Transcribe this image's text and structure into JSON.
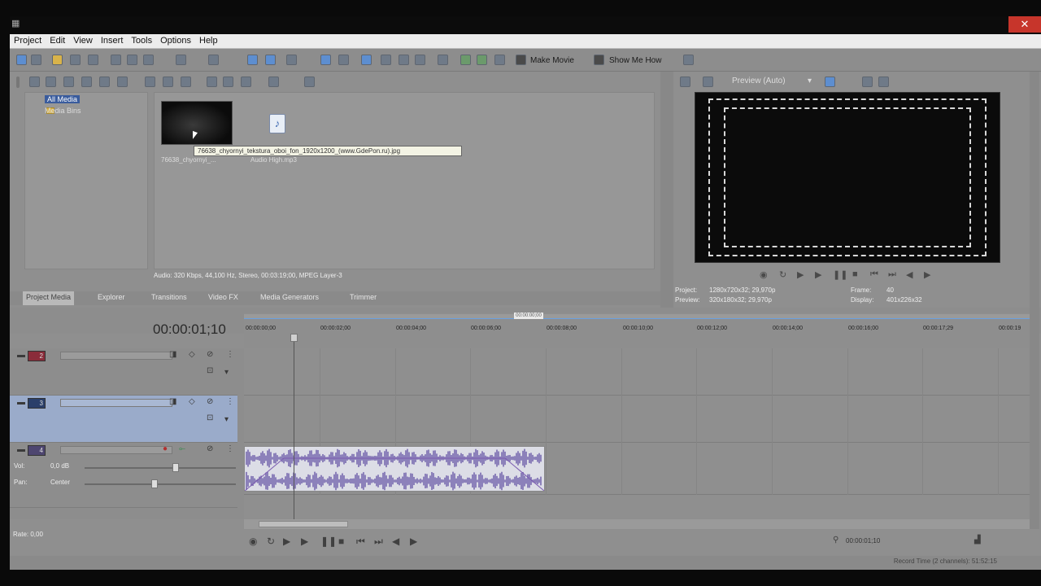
{
  "window": {
    "close_glyph": "✕"
  },
  "menu": [
    "Project",
    "Edit",
    "View",
    "Insert",
    "Tools",
    "Options",
    "Help"
  ],
  "toolbar": {
    "make_movie": "Make Movie",
    "show_me_how": "Show Me How"
  },
  "media": {
    "tree": {
      "all_media": "All Media",
      "media_bins": "Media Bins"
    },
    "thumb_label": "76638_chyornyi_...",
    "audio_label": "Audio High.mp3",
    "tooltip": "76638_chyornyi_tekstura_oboi_fon_1920x1200_(www.GdePon.ru).jpg",
    "info": "Audio: 320 Kbps, 44,100 Hz, Stereo, 00:03:19;00, MPEG Layer-3"
  },
  "pane_tabs": [
    "Project Media",
    "Explorer",
    "Transitions",
    "Video FX",
    "Media Generators",
    "Trimmer"
  ],
  "preview": {
    "mode": "Preview (Auto)",
    "info": {
      "project_label": "Project:",
      "project": "1280x720x32; 29,970p",
      "preview_label": "Preview:",
      "preview": "320x180x32; 29,970p",
      "frame_label": "Frame:",
      "frame": "40",
      "display_label": "Display:",
      "display": "401x226x32"
    }
  },
  "timeline": {
    "timecode": "00:00:01;10",
    "loop_tag": "00:00:00;00",
    "ticks": [
      "00:00:00;00",
      "00:00:02;00",
      "00:00:04;00",
      "00:00:06;00",
      "00:00:08;00",
      "00:00:10;00",
      "00:00:12;00",
      "00:00:14;00",
      "00:00:16;00",
      "00:00:17;29",
      "00:00:19"
    ],
    "tracks": [
      {
        "num": "2",
        "type": "video"
      },
      {
        "num": "3",
        "type": "video"
      },
      {
        "num": "4",
        "type": "audio",
        "vol_label": "Vol:",
        "vol": "0,0 dB",
        "pan_label": "Pan:",
        "pan": "Center"
      }
    ],
    "rate_label": "Rate:",
    "rate": "0,00",
    "transport_timecode": "00:00:01;10"
  },
  "status": {
    "record_time": "Record Time (2 channels): 51:52:15"
  },
  "colors": {
    "accent": "#3a5c9d",
    "selected_track": "#9aabca",
    "waveform": "#6a5aa8",
    "close": "#c7352b"
  }
}
